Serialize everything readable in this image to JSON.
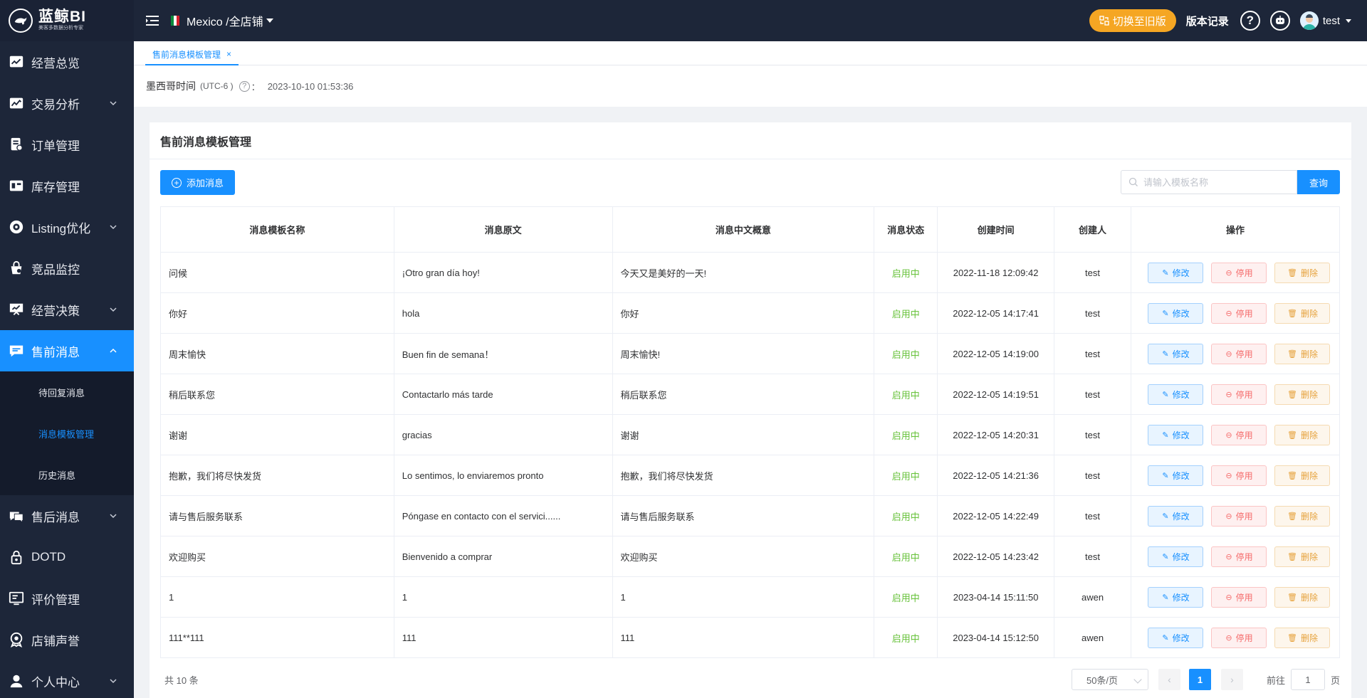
{
  "logo": {
    "title": "蓝鲸BI",
    "subtitle": "美客多数据分析专家"
  },
  "sidebar": {
    "items": [
      {
        "label": "经营总览",
        "icon": "chart-icon"
      },
      {
        "label": "交易分析",
        "icon": "trade-icon",
        "expandable": true
      },
      {
        "label": "订单管理",
        "icon": "order-icon"
      },
      {
        "label": "库存管理",
        "icon": "inventory-icon"
      },
      {
        "label": "Listing优化",
        "icon": "listing-icon",
        "expandable": true
      },
      {
        "label": "竞品监控",
        "icon": "monitor-icon"
      },
      {
        "label": "经营决策",
        "icon": "decision-icon",
        "expandable": true
      },
      {
        "label": "售前消息",
        "icon": "message-icon",
        "expandable": true,
        "active": true
      },
      {
        "label": "售后消息",
        "icon": "after-sale-icon",
        "expandable": true
      },
      {
        "label": "DOTD",
        "icon": "lock-icon"
      },
      {
        "label": "评价管理",
        "icon": "review-icon"
      },
      {
        "label": "店铺声誉",
        "icon": "reputation-icon"
      },
      {
        "label": "个人中心",
        "icon": "user-icon",
        "expandable": true
      }
    ],
    "submenu": [
      {
        "label": "待回复消息"
      },
      {
        "label": "消息模板管理",
        "active": true
      },
      {
        "label": "历史消息"
      }
    ]
  },
  "header": {
    "store": "Mexico /全店铺",
    "switch_label": "切换至旧版",
    "version_label": "版本记录",
    "help": "?",
    "user": "test"
  },
  "tabs": [
    {
      "label": "售前消息模板管理",
      "close": "×"
    }
  ],
  "time_row": {
    "label": "墨西哥时间",
    "tz": "(UTC-6 )",
    "help": "?",
    "colon": "：",
    "value": "2023-10-10 01:53:36"
  },
  "card": {
    "title": "售前消息模板管理",
    "add_label": "添加消息",
    "search_placeholder": "请输入模板名称",
    "search_label": "查询"
  },
  "table": {
    "columns": [
      "消息模板名称",
      "消息原文",
      "消息中文概意",
      "消息状态",
      "创建时间",
      "创建人",
      "操作"
    ],
    "rows": [
      {
        "name": "问候",
        "original": "¡Otro gran día hoy!",
        "cn": "今天又是美好的一天!",
        "status": "启用中",
        "time": "2022-11-18 12:09:42",
        "creator": "test"
      },
      {
        "name": "你好",
        "original": "hola",
        "cn": "你好",
        "status": "启用中",
        "time": "2022-12-05 14:17:41",
        "creator": "test"
      },
      {
        "name": "周末愉快",
        "original": "Buen fin de semana！",
        "cn": "周末愉快!",
        "status": "启用中",
        "time": "2022-12-05 14:19:00",
        "creator": "test"
      },
      {
        "name": "稍后联系您",
        "original": "Contactarlo más tarde",
        "cn": "稍后联系您",
        "status": "启用中",
        "time": "2022-12-05 14:19:51",
        "creator": "test"
      },
      {
        "name": "谢谢",
        "original": "gracias",
        "cn": "谢谢",
        "status": "启用中",
        "time": "2022-12-05 14:20:31",
        "creator": "test"
      },
      {
        "name": "抱歉，我们将尽快发货",
        "original": "Lo sentimos, lo enviaremos pronto",
        "cn": "抱歉，我们将尽快发货",
        "status": "启用中",
        "time": "2022-12-05 14:21:36",
        "creator": "test"
      },
      {
        "name": "请与售后服务联系",
        "original": "Póngase en contacto con el servici......",
        "cn": "请与售后服务联系",
        "status": "启用中",
        "time": "2022-12-05 14:22:49",
        "creator": "test"
      },
      {
        "name": "欢迎购买",
        "original": "Bienvenido a comprar",
        "cn": "欢迎购买",
        "status": "启用中",
        "time": "2022-12-05 14:23:42",
        "creator": "test"
      },
      {
        "name": "1",
        "original": "1",
        "cn": "1",
        "status": "启用中",
        "time": "2023-04-14 15:11:50",
        "creator": "awen"
      },
      {
        "name": "111**111",
        "original": "111",
        "cn": "111",
        "status": "启用中",
        "time": "2023-04-14 15:12:50",
        "creator": "awen"
      }
    ],
    "ops": {
      "edit": "修改",
      "disable": "停用",
      "delete": "删除"
    }
  },
  "pager": {
    "total": "共 10 条",
    "page_size": "50条/页",
    "prev": "‹",
    "current": "1",
    "next": "›",
    "goto_label": "前往",
    "goto_value": "1",
    "page_suffix": "页"
  },
  "colors": {
    "primary": "#1890ff",
    "sidebar": "#1d2639",
    "accent_orange": "#f5a623",
    "status_green": "#67c23a"
  }
}
